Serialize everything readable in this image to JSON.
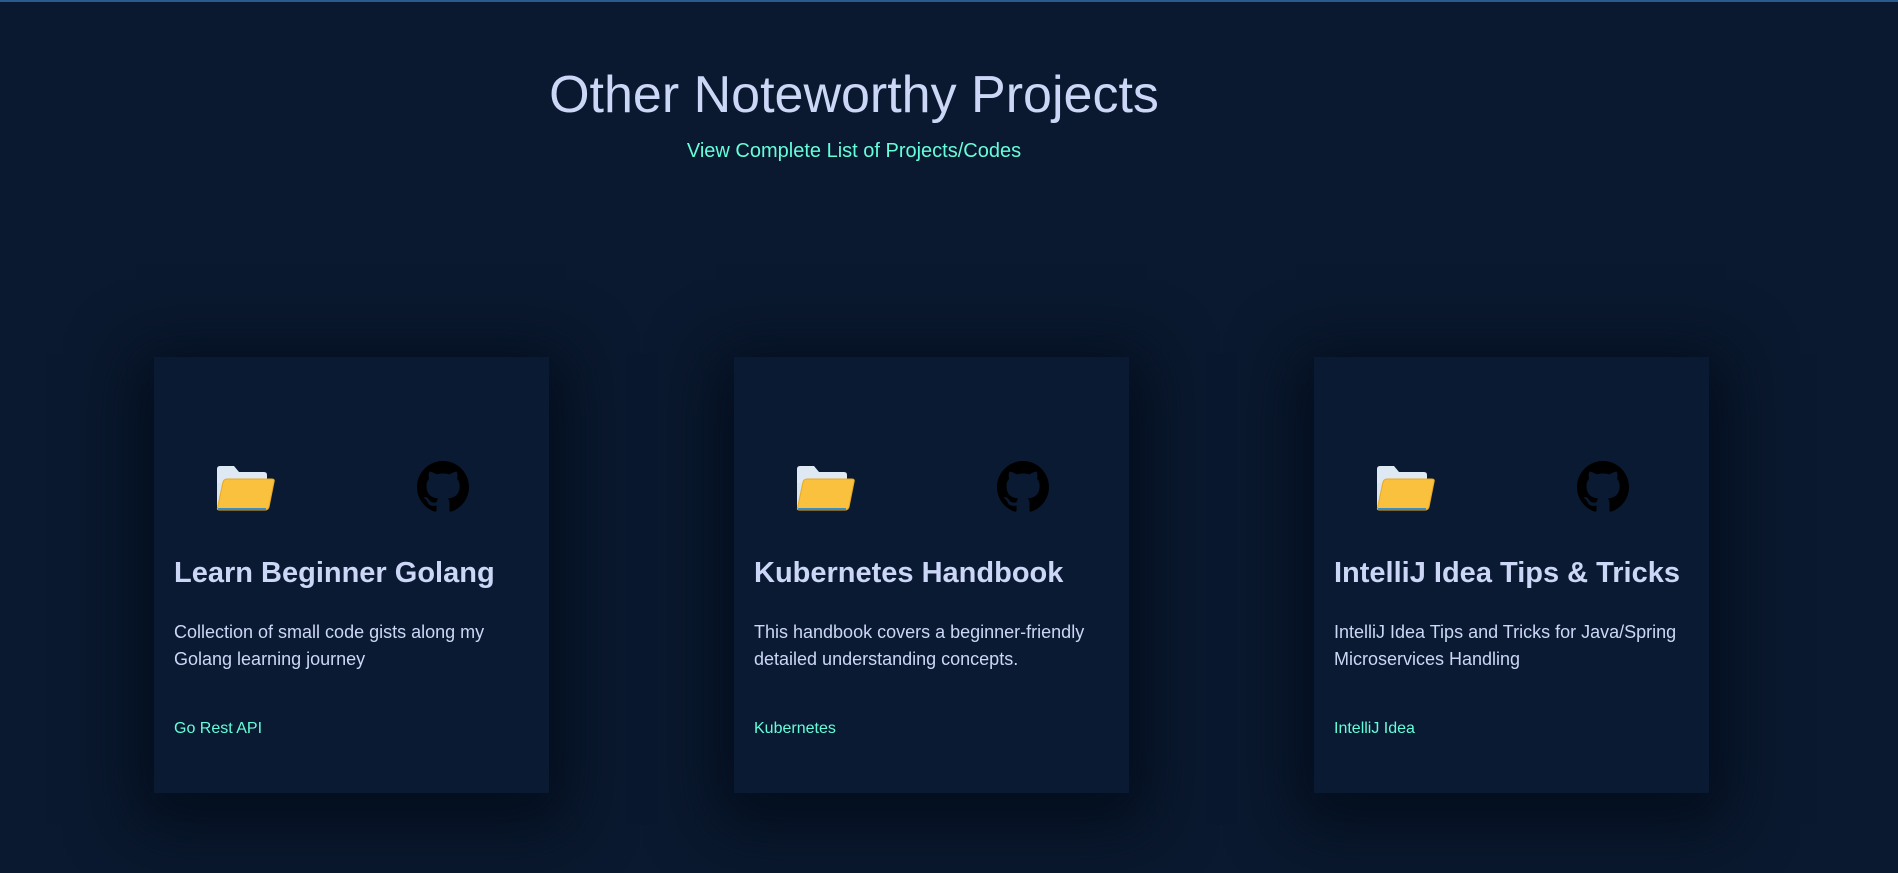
{
  "section": {
    "title": "Other Noteworthy Projects",
    "view_all_link": "View Complete List of Projects/Codes"
  },
  "colors": {
    "background": "#0a192f",
    "card_background": "#0b1a33",
    "text": "#ccd6f6",
    "accent": "#64ffda",
    "folder": "#f9c13d"
  },
  "projects": [
    {
      "title": "Learn Beginner Golang",
      "description": "Collection of small code gists along my Golang learning journey",
      "tag": "Go Rest API",
      "icons": [
        "folder-icon",
        "github-icon"
      ]
    },
    {
      "title": "Kubernetes Handbook",
      "description": "This handbook covers a beginner-friendly detailed understanding concepts.",
      "tag": "Kubernetes",
      "icons": [
        "folder-icon",
        "github-icon"
      ]
    },
    {
      "title": "IntelliJ Idea Tips & Tricks",
      "description": "IntelliJ Idea Tips and Tricks for Java/Spring Microservices Handling",
      "tag": "IntelliJ Idea",
      "icons": [
        "folder-icon",
        "github-icon"
      ]
    }
  ]
}
